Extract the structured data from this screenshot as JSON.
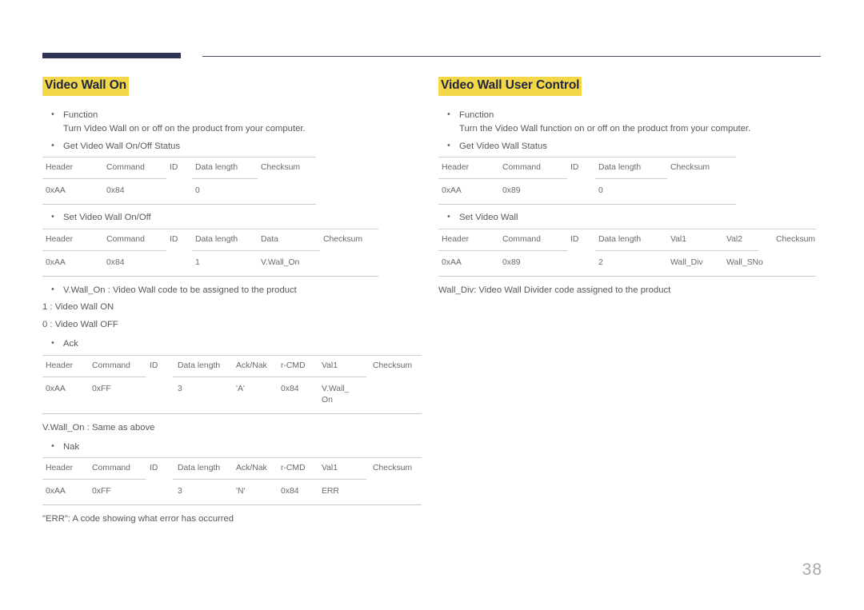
{
  "page": {
    "number": "38",
    "accent_dark": "#2e3356",
    "highlight_yellow": "#f2d749",
    "body_text": "#58585b"
  },
  "left": {
    "title": "Video Wall On",
    "function_label": "Function",
    "function_text": "Turn Video Wall on or off on the product from your computer.",
    "get_label": "Get Video Wall On/Off Status",
    "get_table": {
      "headers": [
        "Header",
        "Command",
        "ID",
        "Data length",
        "Checksum"
      ],
      "values": [
        "0xAA",
        "0x84",
        "",
        "0",
        ""
      ]
    },
    "set_label": "Set Video Wall On/Off",
    "set_table": {
      "headers": [
        "Header",
        "Command",
        "ID",
        "Data length",
        "Data",
        "Checksum"
      ],
      "values": [
        "0xAA",
        "0x84",
        "",
        "1",
        "V.Wall_On",
        ""
      ]
    },
    "vwall_bullet": "V.Wall_On : Video Wall code to be assigned to the product",
    "code_on": "1 : Video Wall ON",
    "code_off": "0 : Video Wall OFF",
    "ack_label": "Ack",
    "ack_table": {
      "headers": [
        "Header",
        "Command",
        "ID",
        "Data length",
        "Ack/Nak",
        "r-CMD",
        "Val1",
        "Checksum"
      ],
      "values": [
        "0xAA",
        "0xFF",
        "",
        "3",
        "'A'",
        "0x84",
        "V.Wall_ On",
        ""
      ]
    },
    "ack_note": "V.Wall_On : Same as above",
    "nak_label": "Nak",
    "nak_table": {
      "headers": [
        "Header",
        "Command",
        "ID",
        "Data length",
        "Ack/Nak",
        "r-CMD",
        "Val1",
        "Checksum"
      ],
      "values": [
        "0xAA",
        "0xFF",
        "",
        "3",
        "'N'",
        "0x84",
        "ERR",
        ""
      ]
    },
    "err_note": "\"ERR\": A code showing what error has occurred"
  },
  "right": {
    "title": "Video Wall User Control",
    "function_label": "Function",
    "function_text": "Turn the Video Wall function on or off on the product from your computer.",
    "get_label": "Get Video Wall Status",
    "get_table": {
      "headers": [
        "Header",
        "Command",
        "ID",
        "Data length",
        "Checksum"
      ],
      "values": [
        "0xAA",
        "0x89",
        "",
        "0",
        ""
      ]
    },
    "set_label": "Set Video Wall",
    "set_table": {
      "headers": [
        "Header",
        "Command",
        "ID",
        "Data length",
        "Val1",
        "Val2",
        "Checksum"
      ],
      "values": [
        "0xAA",
        "0x89",
        "",
        "2",
        "Wall_Div",
        "Wall_SNo",
        ""
      ]
    },
    "wall_div_note": "Wall_Div: Video Wall Divider code assigned to the product"
  }
}
